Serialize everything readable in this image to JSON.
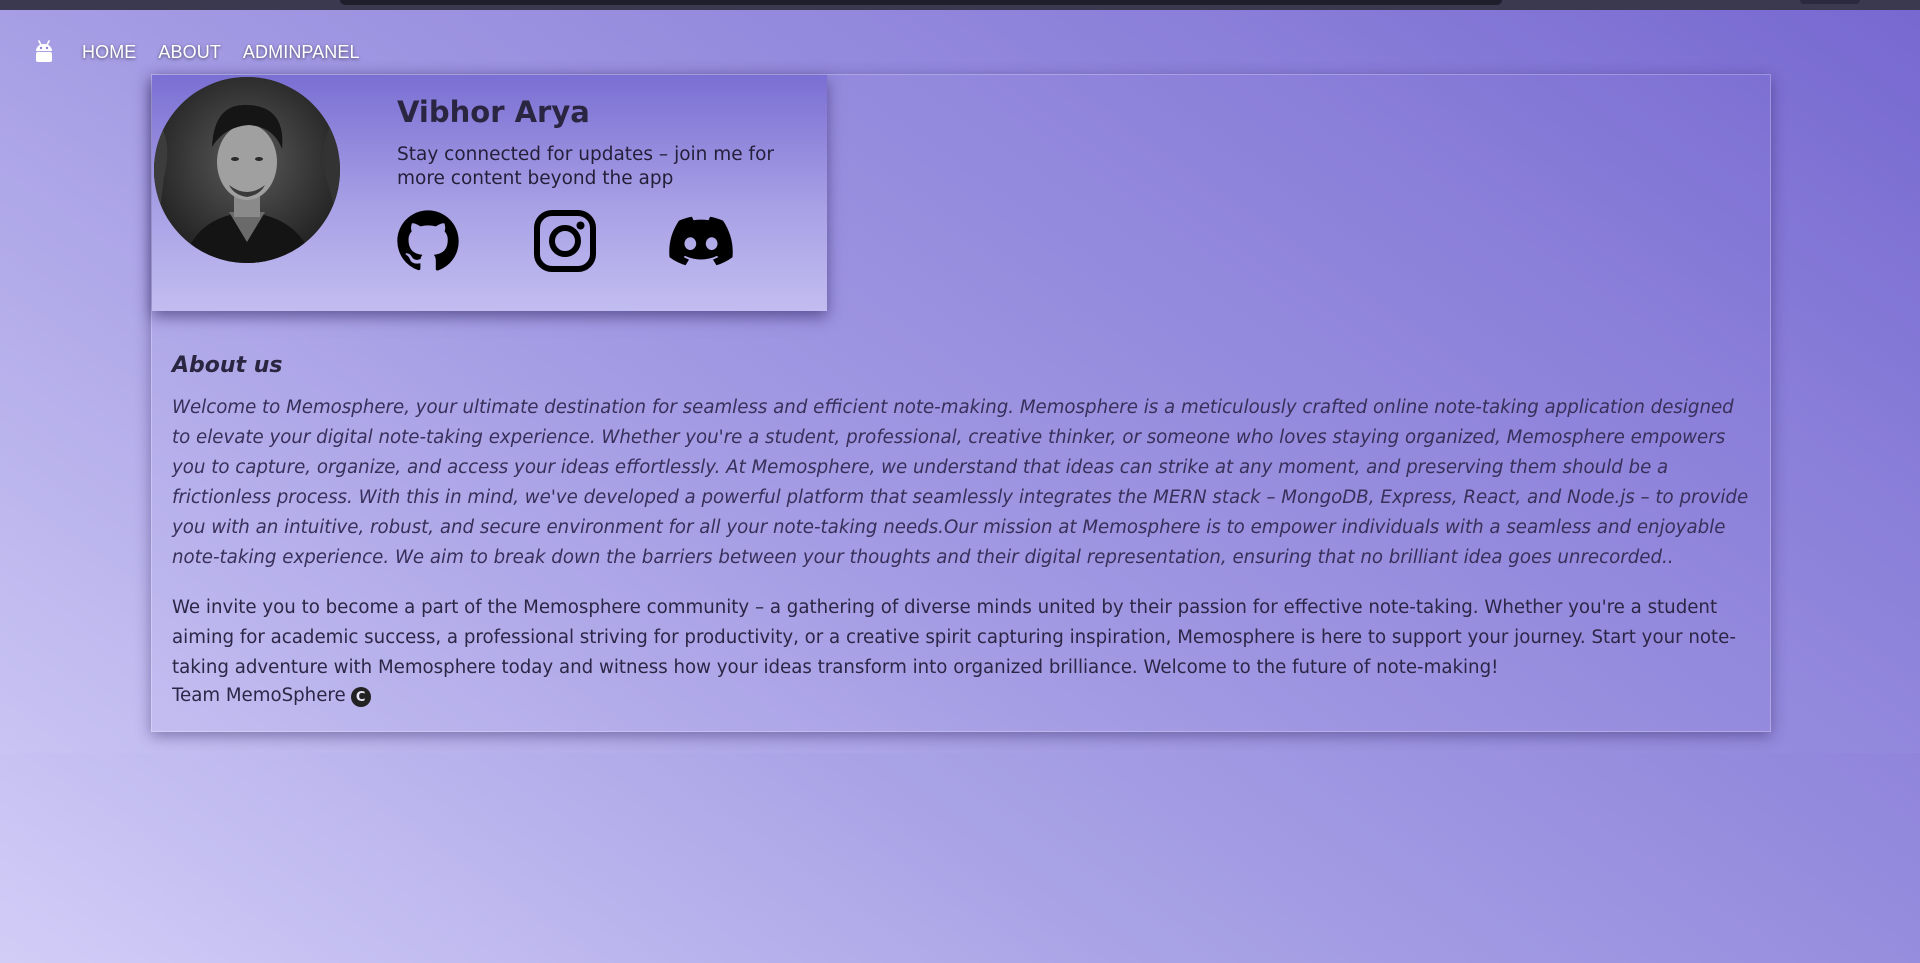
{
  "nav": {
    "logo_icon": "android-icon",
    "links": [
      "HOME",
      "ABOUT",
      "ADMINPANEL"
    ]
  },
  "profile": {
    "name": "Vibhor Arya",
    "tagline": "Stay connected for updates – join me for more content beyond the app",
    "socials": [
      {
        "icon": "github-icon"
      },
      {
        "icon": "instagram-icon"
      },
      {
        "icon": "discord-icon"
      }
    ]
  },
  "about": {
    "heading": "About us",
    "paragraph_1": "Welcome to Memosphere, your ultimate destination for seamless and efficient note-making. Memosphere is a meticulously crafted online note-taking application designed to elevate your digital note-taking experience. Whether you're a student, professional, creative thinker, or someone who loves staying organized, Memosphere empowers you to capture, organize, and access your ideas effortlessly. At Memosphere, we understand that ideas can strike at any moment, and preserving them should be a frictionless process. With this in mind, we've developed a powerful platform that seamlessly integrates the MERN stack – MongoDB, Express, React, and Node.js – to provide you with an intuitive, robust, and secure environment for all your note-taking needs.Our mission at Memosphere is to empower individuals with a seamless and enjoyable note-taking experience. We aim to break down the barriers between your thoughts and their digital representation, ensuring that no brilliant idea goes unrecorded..",
    "paragraph_2": "We invite you to become a part of the Memosphere community – a gathering of diverse minds united by their passion for effective note-taking. Whether you're a student aiming for academic success, a professional striving for productivity, or a creative spirit capturing inspiration, Memosphere is here to support your journey. Start your note-taking adventure with Memosphere today and witness how your ideas transform into organized brilliance. Welcome to the future of note-making!",
    "signature": "Team MemoSphere",
    "copyright_symbol": "C"
  },
  "colors": {
    "background_start": "#d2cdf7",
    "background_end": "#7465cf",
    "text_dark": "#2a2540"
  }
}
